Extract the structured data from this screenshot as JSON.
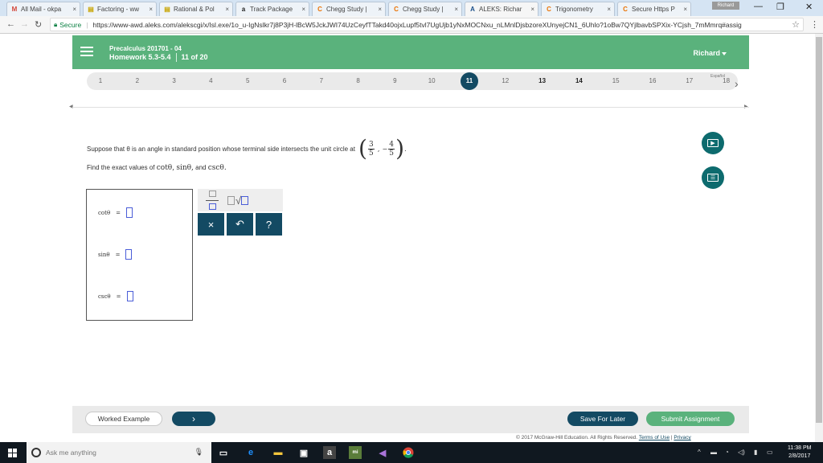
{
  "browser": {
    "tabs": [
      {
        "title": "All Mail - okpa",
        "icon": "gmail-icon",
        "color": "#d44638",
        "glyph": "M"
      },
      {
        "title": "Factoring - ww",
        "icon": "doc-icon",
        "color": "#c8a400",
        "glyph": "▤"
      },
      {
        "title": "Rational & Pol",
        "icon": "doc-icon",
        "color": "#c8a400",
        "glyph": "▤"
      },
      {
        "title": "Track Package",
        "icon": "amazon-icon",
        "color": "#222222",
        "glyph": "a"
      },
      {
        "title": "Chegg Study |",
        "icon": "chegg-icon",
        "color": "#eb7100",
        "glyph": "C"
      },
      {
        "title": "Chegg Study |",
        "icon": "chegg-icon",
        "color": "#eb7100",
        "glyph": "C"
      },
      {
        "title": "ALEKS: Richar",
        "icon": "aleks-icon",
        "color": "#1a4f8a",
        "glyph": "A",
        "active": true
      },
      {
        "title": "Trigonometry",
        "icon": "chegg-icon",
        "color": "#eb7100",
        "glyph": "C"
      },
      {
        "title": "Secure Https P",
        "icon": "chegg-icon",
        "color": "#eb7100",
        "glyph": "C"
      }
    ],
    "user_badge": "Richard",
    "secure_label": "Secure",
    "url": "https://www-awd.aleks.com/alekscgi/x/Isl.exe/1o_u-IgNslkr7j8P3jH-lBcW5JckJWI74UzCeyfTTakd40ojxLupf5tvl7UgUjb1yNxMOCNxu_nLMnlDjsbzoreXUnyejCN1_6Uhlo?1oBw7QYjlbavbSPXix-YCjsh_7mMmrq#assig"
  },
  "header": {
    "course": "Precalculus 201701 - 04",
    "homework": "Homework 5.3-5.4",
    "progress": "11 of 20",
    "user": "Richard"
  },
  "question_nav": {
    "numbers": [
      "1",
      "2",
      "3",
      "4",
      "5",
      "6",
      "7",
      "8",
      "9",
      "10",
      "11",
      "12",
      "13",
      "14",
      "15",
      "16",
      "17",
      "18"
    ],
    "current": "11",
    "bold": [
      "13",
      "14"
    ],
    "espanol": "Español"
  },
  "question": {
    "text": "Suppose that θ is an angle in standard position whose terminal side intersects the unit circle at",
    "point_x_num": "3",
    "point_x_den": "5",
    "point_y_sign": "−",
    "point_y_num": "4",
    "point_y_den": "5",
    "find_prefix": "Find the exact values of",
    "find_cot": "cotθ,",
    "find_sin": "sinθ,",
    "find_and": "and",
    "find_csc": "cscθ."
  },
  "answers": [
    {
      "label": "cotθ",
      "eq": "="
    },
    {
      "label": "sinθ",
      "eq": "="
    },
    {
      "label": "cscθ",
      "eq": "="
    }
  ],
  "toolpad": {
    "clear": "×",
    "undo": "↶",
    "help": "?"
  },
  "footer": {
    "worked_example": "Worked Example",
    "next": "›",
    "save": "Save For Later",
    "submit": "Submit Assignment",
    "copyright": "© 2017 McGraw-Hill Education. All Rights Reserved.",
    "terms": "Terms of Use",
    "privacy": "Privacy"
  },
  "taskbar": {
    "search_placeholder": "Ask me anything",
    "time": "11:38 PM",
    "date": "2/8/2017"
  }
}
